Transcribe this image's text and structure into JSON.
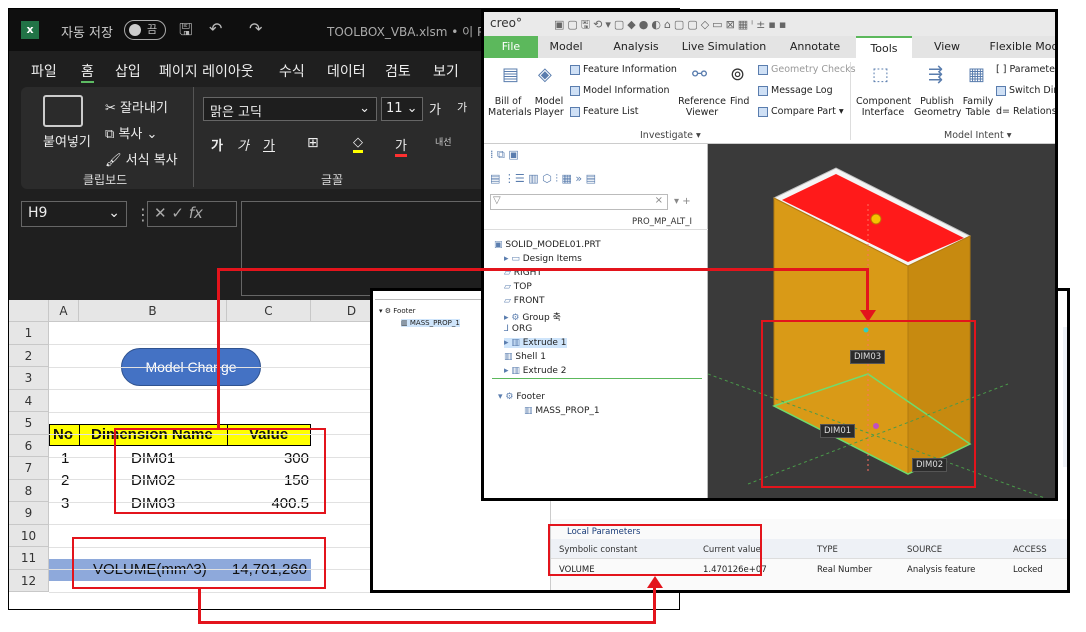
{
  "excel": {
    "title_left": "자동 저장",
    "toggle": "끔",
    "filename": "TOOLBOX_VBA.xlsm • 이 PC",
    "menu": [
      "파일",
      "홈",
      "삽입",
      "페이지 레이아웃",
      "수식",
      "데이터",
      "검토",
      "보기"
    ],
    "ribbon": {
      "paste": "붙여넣기",
      "cut": "잘라내기",
      "copy": "복사",
      "format_painter": "서식 복사",
      "clipboard_group": "클립보드",
      "font_name": "맑은 고딕",
      "font_size": "11",
      "font_group": "글꼴",
      "bold": "가",
      "italic": "가",
      "underline": "가",
      "grow": "가",
      "shrink": "가",
      "wrap": "내선"
    },
    "name_box": "H9",
    "fx": "fx",
    "columns": [
      "A",
      "B",
      "C",
      "D"
    ],
    "rows": [
      "1",
      "2",
      "3",
      "4",
      "5",
      "6",
      "7",
      "8",
      "9",
      "10",
      "11",
      "12"
    ],
    "button": "Model Change",
    "table_header": {
      "no": "No",
      "name": "Dimension Name",
      "value": "Value"
    },
    "table_rows": [
      {
        "no": "1",
        "name": "DIM01",
        "value": "300"
      },
      {
        "no": "2",
        "name": "DIM02",
        "value": "150"
      },
      {
        "no": "3",
        "name": "DIM03",
        "value": "400.5"
      }
    ],
    "volume_label": "VOLUME(mm^3)",
    "volume_value": "14,701,260"
  },
  "creo": {
    "logo": "creo°",
    "tabs": [
      "File",
      "Model",
      "Analysis",
      "Live Simulation",
      "Annotate",
      "Tools",
      "View",
      "Flexible Mod"
    ],
    "active_tab": "Tools",
    "ribbon": {
      "bom": "Bill of Materials",
      "model_player": "Model Player",
      "feature_info": "Feature Information",
      "model_info": "Model Information",
      "feature_list": "Feature List",
      "ref_viewer": "Reference Viewer",
      "find": "Find",
      "geom_checks": "Geometry Checks",
      "message_log": "Message Log",
      "compare_part": "Compare Part",
      "component_interface": "Component Interface",
      "publish_geometry": "Publish Geometry",
      "family_table": "Family Table",
      "parameters": "Parameter",
      "switch_dim": "Switch Dir",
      "relations": "Relations",
      "investigate": "Investigate",
      "model_intent": "Model Intent"
    },
    "column_header": "PRO_MP_ALT_I",
    "tree": [
      "SOLID_MODEL01.PRT",
      "Design Items",
      "RIGHT",
      "TOP",
      "FRONT",
      "Group 축",
      "ORG",
      "Extrude 1",
      "Shell 1",
      "Extrude 2",
      "Footer",
      "MASS_PROP_1"
    ],
    "dims": [
      "DIM03",
      "DIM01",
      "DIM02"
    ]
  },
  "param": {
    "left_tree": [
      "Footer",
      "MASS_PROP_1"
    ],
    "section": "Local Parameters",
    "headers": [
      "Symbolic constant",
      "Current value",
      "TYPE",
      "SOURCE",
      "ACCESS"
    ],
    "row": [
      "VOLUME",
      "1.470126e+07",
      "Real Number",
      "Analysis feature",
      "Locked"
    ]
  },
  "colors": {
    "excel_green": "#217346",
    "creo_green": "#5cb85c",
    "red": "#e3141c",
    "yellow": "#ffff00",
    "volume_blue": "#8ea9db"
  }
}
